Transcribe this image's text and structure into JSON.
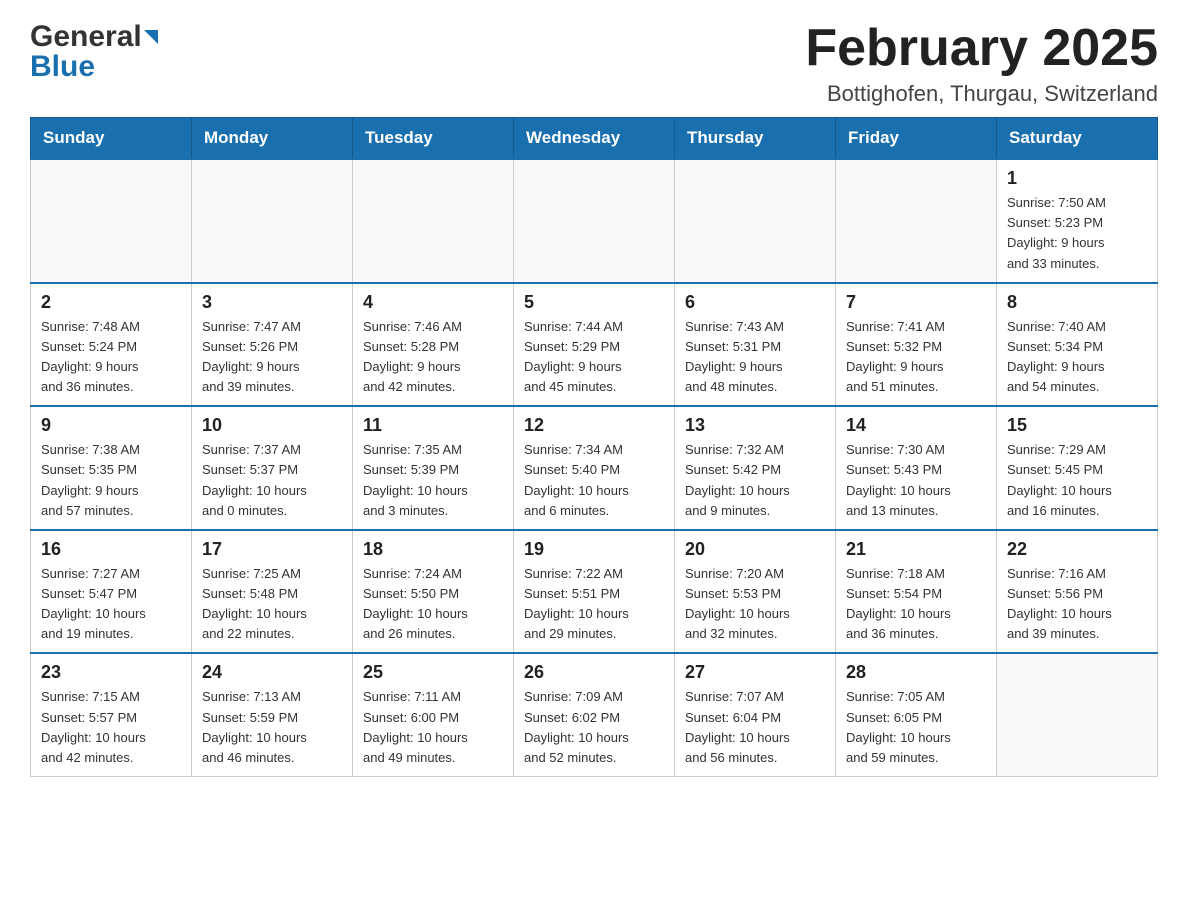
{
  "header": {
    "logo_general": "General",
    "logo_blue": "Blue",
    "title": "February 2025",
    "subtitle": "Bottighofen, Thurgau, Switzerland"
  },
  "weekdays": [
    "Sunday",
    "Monday",
    "Tuesday",
    "Wednesday",
    "Thursday",
    "Friday",
    "Saturday"
  ],
  "weeks": [
    [
      {
        "day": "",
        "info": ""
      },
      {
        "day": "",
        "info": ""
      },
      {
        "day": "",
        "info": ""
      },
      {
        "day": "",
        "info": ""
      },
      {
        "day": "",
        "info": ""
      },
      {
        "day": "",
        "info": ""
      },
      {
        "day": "1",
        "info": "Sunrise: 7:50 AM\nSunset: 5:23 PM\nDaylight: 9 hours\nand 33 minutes."
      }
    ],
    [
      {
        "day": "2",
        "info": "Sunrise: 7:48 AM\nSunset: 5:24 PM\nDaylight: 9 hours\nand 36 minutes."
      },
      {
        "day": "3",
        "info": "Sunrise: 7:47 AM\nSunset: 5:26 PM\nDaylight: 9 hours\nand 39 minutes."
      },
      {
        "day": "4",
        "info": "Sunrise: 7:46 AM\nSunset: 5:28 PM\nDaylight: 9 hours\nand 42 minutes."
      },
      {
        "day": "5",
        "info": "Sunrise: 7:44 AM\nSunset: 5:29 PM\nDaylight: 9 hours\nand 45 minutes."
      },
      {
        "day": "6",
        "info": "Sunrise: 7:43 AM\nSunset: 5:31 PM\nDaylight: 9 hours\nand 48 minutes."
      },
      {
        "day": "7",
        "info": "Sunrise: 7:41 AM\nSunset: 5:32 PM\nDaylight: 9 hours\nand 51 minutes."
      },
      {
        "day": "8",
        "info": "Sunrise: 7:40 AM\nSunset: 5:34 PM\nDaylight: 9 hours\nand 54 minutes."
      }
    ],
    [
      {
        "day": "9",
        "info": "Sunrise: 7:38 AM\nSunset: 5:35 PM\nDaylight: 9 hours\nand 57 minutes."
      },
      {
        "day": "10",
        "info": "Sunrise: 7:37 AM\nSunset: 5:37 PM\nDaylight: 10 hours\nand 0 minutes."
      },
      {
        "day": "11",
        "info": "Sunrise: 7:35 AM\nSunset: 5:39 PM\nDaylight: 10 hours\nand 3 minutes."
      },
      {
        "day": "12",
        "info": "Sunrise: 7:34 AM\nSunset: 5:40 PM\nDaylight: 10 hours\nand 6 minutes."
      },
      {
        "day": "13",
        "info": "Sunrise: 7:32 AM\nSunset: 5:42 PM\nDaylight: 10 hours\nand 9 minutes."
      },
      {
        "day": "14",
        "info": "Sunrise: 7:30 AM\nSunset: 5:43 PM\nDaylight: 10 hours\nand 13 minutes."
      },
      {
        "day": "15",
        "info": "Sunrise: 7:29 AM\nSunset: 5:45 PM\nDaylight: 10 hours\nand 16 minutes."
      }
    ],
    [
      {
        "day": "16",
        "info": "Sunrise: 7:27 AM\nSunset: 5:47 PM\nDaylight: 10 hours\nand 19 minutes."
      },
      {
        "day": "17",
        "info": "Sunrise: 7:25 AM\nSunset: 5:48 PM\nDaylight: 10 hours\nand 22 minutes."
      },
      {
        "day": "18",
        "info": "Sunrise: 7:24 AM\nSunset: 5:50 PM\nDaylight: 10 hours\nand 26 minutes."
      },
      {
        "day": "19",
        "info": "Sunrise: 7:22 AM\nSunset: 5:51 PM\nDaylight: 10 hours\nand 29 minutes."
      },
      {
        "day": "20",
        "info": "Sunrise: 7:20 AM\nSunset: 5:53 PM\nDaylight: 10 hours\nand 32 minutes."
      },
      {
        "day": "21",
        "info": "Sunrise: 7:18 AM\nSunset: 5:54 PM\nDaylight: 10 hours\nand 36 minutes."
      },
      {
        "day": "22",
        "info": "Sunrise: 7:16 AM\nSunset: 5:56 PM\nDaylight: 10 hours\nand 39 minutes."
      }
    ],
    [
      {
        "day": "23",
        "info": "Sunrise: 7:15 AM\nSunset: 5:57 PM\nDaylight: 10 hours\nand 42 minutes."
      },
      {
        "day": "24",
        "info": "Sunrise: 7:13 AM\nSunset: 5:59 PM\nDaylight: 10 hours\nand 46 minutes."
      },
      {
        "day": "25",
        "info": "Sunrise: 7:11 AM\nSunset: 6:00 PM\nDaylight: 10 hours\nand 49 minutes."
      },
      {
        "day": "26",
        "info": "Sunrise: 7:09 AM\nSunset: 6:02 PM\nDaylight: 10 hours\nand 52 minutes."
      },
      {
        "day": "27",
        "info": "Sunrise: 7:07 AM\nSunset: 6:04 PM\nDaylight: 10 hours\nand 56 minutes."
      },
      {
        "day": "28",
        "info": "Sunrise: 7:05 AM\nSunset: 6:05 PM\nDaylight: 10 hours\nand 59 minutes."
      },
      {
        "day": "",
        "info": ""
      }
    ]
  ]
}
